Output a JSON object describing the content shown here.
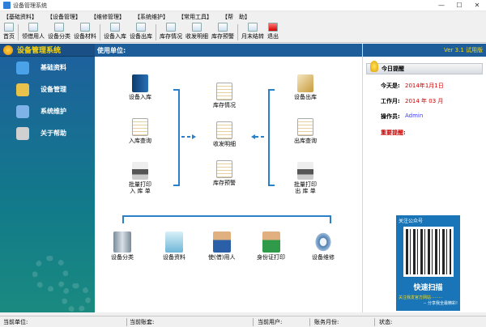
{
  "window": {
    "title": "设备管理系统",
    "min": "—",
    "max": "☐",
    "close": "✕"
  },
  "menu": [
    "【基础资料】",
    "【设备管理】",
    "【维修管理】",
    "【系统维护】",
    "【常用工具】",
    "【帮　助】"
  ],
  "toolbar": [
    {
      "label": "首页",
      "icon": "home-icon"
    },
    {
      "label": "领借用人",
      "icon": "user-icon"
    },
    {
      "label": "设备分类",
      "icon": "category-icon"
    },
    {
      "label": "设备材料",
      "icon": "material-icon"
    },
    {
      "label": "设备入库",
      "icon": "inbound-icon"
    },
    {
      "label": "设备出库",
      "icon": "outbound-icon"
    },
    {
      "label": "库存情况",
      "icon": "inventory-icon"
    },
    {
      "label": "收发明细",
      "icon": "detail-icon"
    },
    {
      "label": "库存预警",
      "icon": "warning-icon"
    },
    {
      "label": "月末结转",
      "icon": "monthend-icon"
    },
    {
      "label": "退出",
      "icon": "exit-icon"
    }
  ],
  "sidebar": {
    "title": "设备管理系统",
    "items": [
      {
        "label": "基础资料",
        "color": "#4aa3e8"
      },
      {
        "label": "设备管理",
        "color": "#e8c24a"
      },
      {
        "label": "系统维护",
        "color": "#7fb3e8"
      },
      {
        "label": "关于帮助",
        "color": "#d0d0d0"
      }
    ]
  },
  "main": {
    "unit_label": "使用单位:",
    "left_modules": [
      "设备入库",
      "入库查询",
      "批量打印\n入 库 单"
    ],
    "center_modules": [
      "库存情况",
      "收发明细",
      "库存预警"
    ],
    "right_modules": [
      "设备出库",
      "出库查询",
      "批量打印\n出 库 单"
    ],
    "bottom_modules": [
      "设备分类",
      "设备资料",
      "使(借)用人",
      "身份证打印",
      "设备维修"
    ]
  },
  "right_panel": {
    "version": "Ver 3.1 试用版",
    "reminder_title": "今日提醒",
    "today_label": "今天是:",
    "today_value": "2014年1月1日",
    "work_month_label": "工作月:",
    "work_month_value": "2014 年 03 月",
    "operator_label": "操作员:",
    "operator_value": "Admin",
    "alert": "重要提醒:",
    "qr_follow": "关注公众号",
    "qr_scan": "快速扫描",
    "qr_sub": "关注我发官方网站·········",
    "qr_sub2": "-- 分享我全最精彩!"
  },
  "status": {
    "unit": "当前单位:",
    "account": "当前账套:",
    "user": "当前用户:",
    "period": "账务月份:",
    "state": "状态:"
  }
}
